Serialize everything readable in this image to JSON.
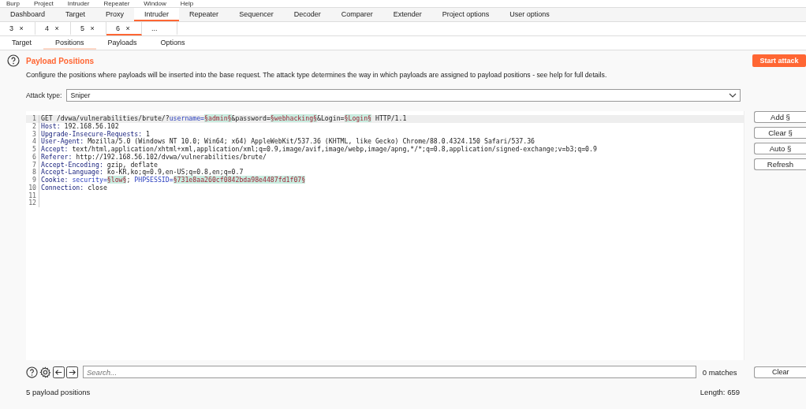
{
  "menu": [
    "Burp",
    "Project",
    "Intruder",
    "Repeater",
    "Window",
    "Help"
  ],
  "tabs": [
    {
      "label": "Dashboard",
      "selected": false
    },
    {
      "label": "Target",
      "selected": false
    },
    {
      "label": "Proxy",
      "selected": false
    },
    {
      "label": "Intruder",
      "selected": true
    },
    {
      "label": "Repeater",
      "selected": false
    },
    {
      "label": "Sequencer",
      "selected": false
    },
    {
      "label": "Decoder",
      "selected": false
    },
    {
      "label": "Comparer",
      "selected": false
    },
    {
      "label": "Extender",
      "selected": false
    },
    {
      "label": "Project options",
      "selected": false
    },
    {
      "label": "User options",
      "selected": false
    }
  ],
  "attack_tabs": [
    {
      "label": "3",
      "close": "×",
      "selected": false
    },
    {
      "label": "4",
      "close": "×",
      "selected": false
    },
    {
      "label": "5",
      "close": "×",
      "selected": false
    },
    {
      "label": "6",
      "close": "×",
      "selected": true
    },
    {
      "label": "...",
      "selected": false
    }
  ],
  "sub_tabs": [
    {
      "label": "Target",
      "selected": false
    },
    {
      "label": "Positions",
      "selected": true
    },
    {
      "label": "Payloads",
      "selected": false
    },
    {
      "label": "Options",
      "selected": false
    }
  ],
  "section": {
    "title": "Payload Positions",
    "description": "Configure the positions where payloads will be inserted into the base request. The attack type determines the way in which payloads are assigned to payload positions - see help for full details.",
    "start_button": "Start attack"
  },
  "attack_type": {
    "label": "Attack type:",
    "value": "Sniper"
  },
  "request": {
    "lines": [
      {
        "number": "1",
        "current": true,
        "segments": [
          {
            "kind": "text",
            "text": "GET /dvwa/vulnerabilities/brute/?"
          },
          {
            "kind": "param",
            "text": "username="
          },
          {
            "kind": "payload",
            "text": "§admin§"
          },
          {
            "kind": "text",
            "text": "&password="
          },
          {
            "kind": "payload",
            "text": "§webhacking§"
          },
          {
            "kind": "text",
            "text": "&Login="
          },
          {
            "kind": "payload",
            "text": "§Login§"
          },
          {
            "kind": "text",
            "text": " HTTP/1.1"
          }
        ]
      },
      {
        "number": "2",
        "current": false,
        "segments": [
          {
            "kind": "header",
            "text": "Host:"
          },
          {
            "kind": "text",
            "text": " 192.168.56.102"
          }
        ]
      },
      {
        "number": "3",
        "current": false,
        "segments": [
          {
            "kind": "header",
            "text": "Upgrade-Insecure-Requests:"
          },
          {
            "kind": "text",
            "text": " 1"
          }
        ]
      },
      {
        "number": "4",
        "current": false,
        "segments": [
          {
            "kind": "header",
            "text": "User-Agent:"
          },
          {
            "kind": "text",
            "text": " Mozilla/5.0 (Windows NT 10.0; Win64; x64) AppleWebKit/537.36 (KHTML, like Gecko) Chrome/88.0.4324.150 Safari/537.36"
          }
        ]
      },
      {
        "number": "5",
        "current": false,
        "segments": [
          {
            "kind": "header",
            "text": "Accept:"
          },
          {
            "kind": "text",
            "text": " text/html,application/xhtml+xml,application/xml;q=0.9,image/avif,image/webp,image/apng,*/*;q=0.8,application/signed-exchange;v=b3;q=0.9"
          }
        ]
      },
      {
        "number": "6",
        "current": false,
        "segments": [
          {
            "kind": "header",
            "text": "Referer:"
          },
          {
            "kind": "text",
            "text": " http://192.168.56.102/dvwa/vulnerabilities/brute/"
          }
        ]
      },
      {
        "number": "7",
        "current": false,
        "segments": [
          {
            "kind": "header",
            "text": "Accept-Encoding:"
          },
          {
            "kind": "text",
            "text": " gzip, deflate"
          }
        ]
      },
      {
        "number": "8",
        "current": false,
        "segments": [
          {
            "kind": "header",
            "text": "Accept-Language:"
          },
          {
            "kind": "text",
            "text": " ko-KR,ko;q=0.9,en-US;q=0.8,en;q=0.7"
          }
        ]
      },
      {
        "number": "9",
        "current": false,
        "segments": [
          {
            "kind": "header",
            "text": "Cookie:"
          },
          {
            "kind": "param",
            "text": " security="
          },
          {
            "kind": "payload",
            "text": "§low§"
          },
          {
            "kind": "text",
            "text": "; "
          },
          {
            "kind": "param",
            "text": "PHPSESSID="
          },
          {
            "kind": "payload",
            "text": "§731e8aa260cf0842bda98e4487fd1f07§"
          }
        ]
      },
      {
        "number": "10",
        "current": false,
        "segments": [
          {
            "kind": "header",
            "text": "Connection:"
          },
          {
            "kind": "text",
            "text": " close"
          }
        ]
      },
      {
        "number": "11",
        "current": false
      },
      {
        "number": "12",
        "current": false
      }
    ]
  },
  "side_buttons": [
    "Add §",
    "Clear §",
    "Auto §",
    "Refresh"
  ],
  "search": {
    "placeholder": "Search...",
    "matches": "0 matches",
    "clear_button": "Clear"
  },
  "status_bar": {
    "positions": "5 payload positions",
    "length": "Length: 659"
  }
}
